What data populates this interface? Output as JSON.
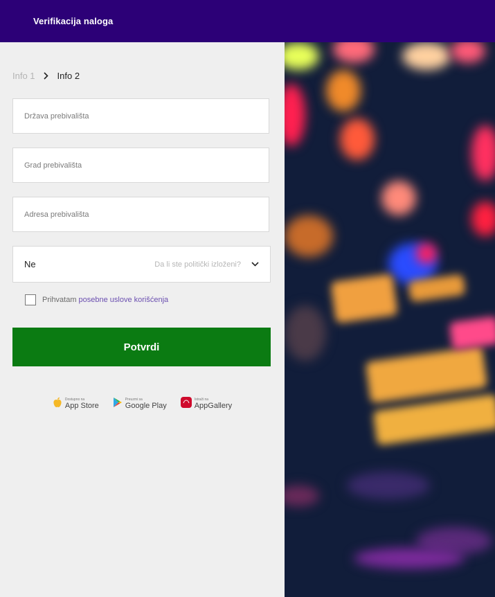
{
  "header": {
    "title": "Verifikacija naloga"
  },
  "breadcrumb": {
    "step1": "Info 1",
    "step2": "Info 2"
  },
  "form": {
    "country_placeholder": "Država prebivališta",
    "city_placeholder": "Grad prebivališta",
    "address_placeholder": "Adresa prebivališta",
    "political_value": "Ne",
    "political_label": "Da li ste politički izloženi?",
    "terms_text": "Prihvatam",
    "terms_link": "posebne uslove korišćenja",
    "submit_label": "Potvrdi"
  },
  "stores": [
    {
      "small": "Dostupno na",
      "name": "App Store",
      "icon": "apple-icon"
    },
    {
      "small": "Preuzmi sa",
      "name": "Google Play",
      "icon": "google-play-icon"
    },
    {
      "small": "Istraži na",
      "name": "AppGallery",
      "icon": "huawei-icon"
    }
  ],
  "colors": {
    "header_bg": "#2c0077",
    "button_green": "#0b7b12",
    "link_purple": "#6b4fb0"
  }
}
